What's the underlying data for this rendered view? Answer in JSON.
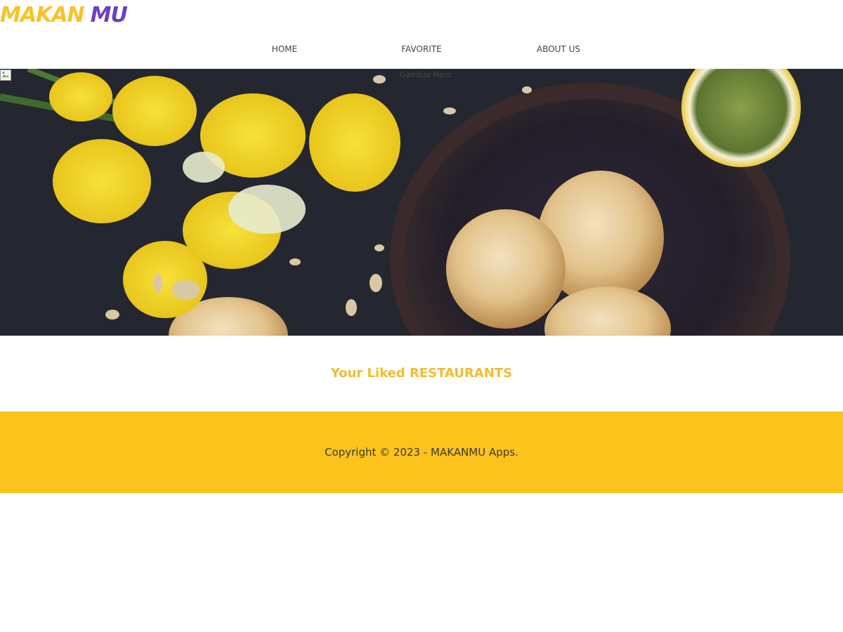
{
  "header": {
    "logo_part1": "MAKAN",
    "logo_part2": "MU",
    "nav": [
      {
        "label": "HOME"
      },
      {
        "label": "FAVORITE"
      },
      {
        "label": "ABOUT US"
      }
    ]
  },
  "hero": {
    "alt_text": "Gambar Hero",
    "icon": "broken-image-icon"
  },
  "main": {
    "title": "Your Liked RESTAURANTS"
  },
  "footer": {
    "copyright": "Copyright © 2023 - MAKANMU Apps."
  },
  "colors": {
    "brand_yellow": "#f9c22a",
    "brand_purple": "#6e3fc2",
    "footer_bg": "#fbc31b",
    "title": "#f1bc2f"
  }
}
